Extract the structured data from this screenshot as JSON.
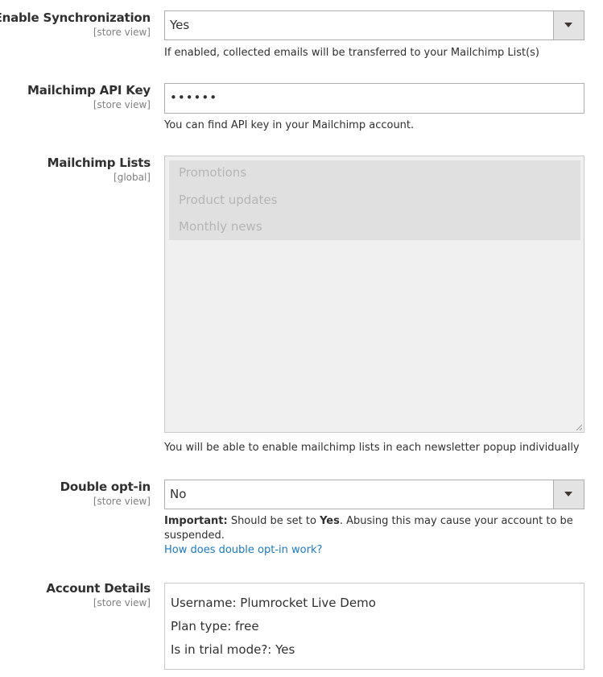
{
  "fields": {
    "sync": {
      "label": "Enable Synchronization",
      "scope": "[store view]",
      "value": "Yes",
      "note": "If enabled, collected emails will be transferred to your Mailchimp List(s)"
    },
    "api_key": {
      "label": "Mailchimp API Key",
      "scope": "[store view]",
      "value": "••••••",
      "note": "You can find API key in your Mailchimp account."
    },
    "lists": {
      "label": "Mailchimp Lists",
      "scope": "[global]",
      "options": [
        "Promotions",
        "Product updates",
        "Monthly news"
      ],
      "note": "You will be able to enable mailchimp lists in each newsletter popup individually"
    },
    "double_optin": {
      "label": "Double opt-in",
      "scope": "[store view]",
      "value": "No",
      "note_important": "Important:",
      "note_part1": " Should be set to ",
      "note_yes": "Yes",
      "note_part2": ". Abusing this may cause your account to be",
      "note_part3": "suspended.",
      "link": "How does double opt-in work?"
    },
    "account": {
      "label": "Account Details",
      "scope": "[store view]",
      "lines": [
        "Username: Plumrocket Live Demo",
        "Plan type: free",
        "Is in trial mode?: Yes"
      ]
    }
  },
  "colors": {
    "link": "#1979c3",
    "text": "#303030",
    "scope": "#808080",
    "disabled_text": "#b5b5b5"
  }
}
